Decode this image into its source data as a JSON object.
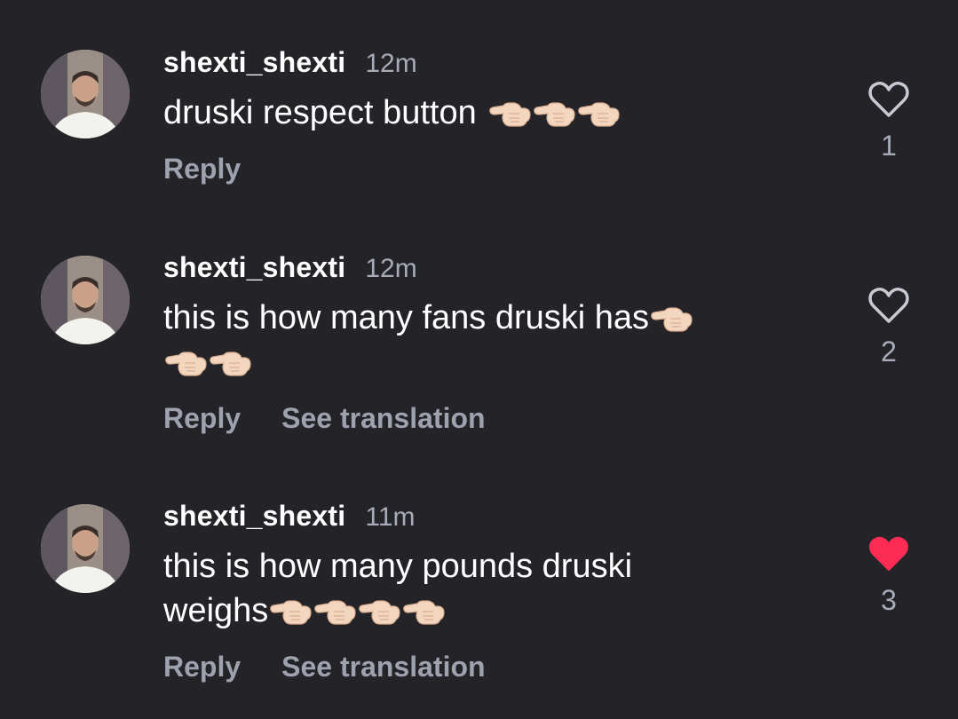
{
  "comments": [
    {
      "username": "shexti_shexti",
      "time": "12m",
      "lines": [
        "druski respect button"
      ],
      "hands_line1": 3,
      "hands_line2": 0,
      "reply_label": "Reply",
      "translate_label": "",
      "likes": "1",
      "liked": false
    },
    {
      "username": "shexti_shexti",
      "time": "12m",
      "lines": [
        "this is how many fans druski has",
        ""
      ],
      "hands_line1": 1,
      "hands_line2": 2,
      "reply_label": "Reply",
      "translate_label": "See translation",
      "likes": "2",
      "liked": false
    },
    {
      "username": "shexti_shexti",
      "time": "11m",
      "lines": [
        "this is how many pounds druski",
        "weighs"
      ],
      "hands_line1": 0,
      "hands_line2": 4,
      "reply_label": "Reply",
      "translate_label": "See translation",
      "likes": "3",
      "liked": true
    }
  ],
  "icons": {
    "hand": "backhand-index-pointing-left-emoji",
    "like": "heart-icon"
  },
  "colors": {
    "background": "#232328",
    "username": "#ffffff",
    "secondary": "#a7abb8",
    "liked_heart": "#fe2c55",
    "unliked_heart": "#c8cad1"
  }
}
